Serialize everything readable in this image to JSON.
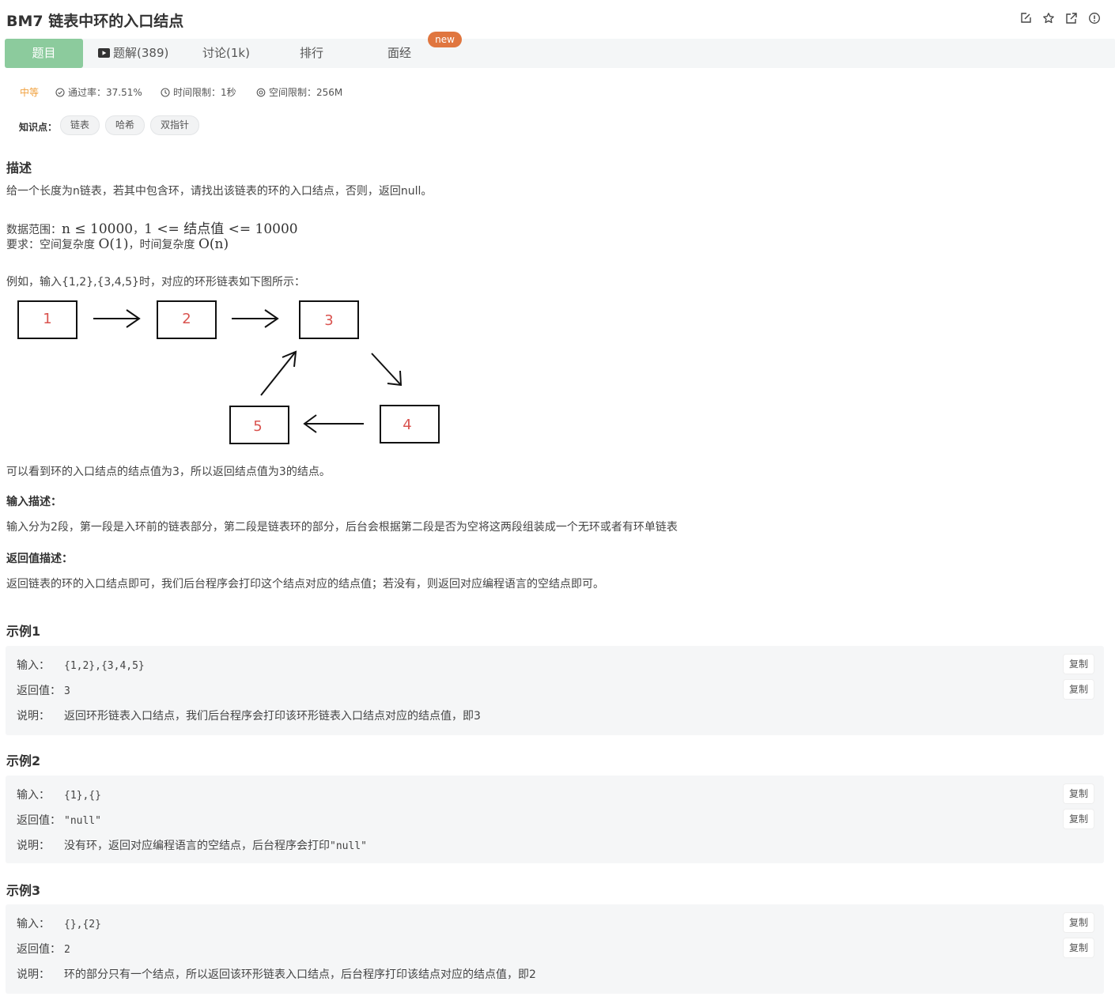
{
  "header": {
    "title": "BM7  链表中环的入口结点",
    "icons": [
      "edit-icon",
      "star-icon",
      "share-icon",
      "report-icon"
    ]
  },
  "tabs": [
    {
      "label": "题目",
      "active": true
    },
    {
      "label": "题解(389)",
      "icon": "video-icon"
    },
    {
      "label": "讨论(1k)"
    },
    {
      "label": "排行"
    },
    {
      "label": "面经"
    }
  ],
  "new_badge": "new",
  "meta": {
    "difficulty": "中等",
    "pass_rate": "通过率：37.51%",
    "time_limit": "时间限制：1秒",
    "space_limit": "空间限制：256M"
  },
  "knowledge": {
    "label": "知识点：",
    "tags": [
      "链表",
      "哈希",
      "双指针"
    ]
  },
  "description": {
    "heading": "描述",
    "p1": "给一个长度为n链表，若其中包含环，请找出该链表的环的入口结点，否则，返回null。",
    "range_prefix": "数据范围：",
    "range_math1": "n ≤ 10000",
    "range_sep": "，",
    "range_math2": "1 <= 结点值 <= 10000",
    "req_prefix": "要求：空间复杂度 ",
    "req_math1": "O(1)",
    "req_mid": "，时间复杂度 ",
    "req_math2": "O(n)",
    "example_intro": "例如，输入{1,2},{3,4,5}时，对应的环形链表如下图所示：",
    "diagram_nodes": [
      "1",
      "2",
      "3",
      "4",
      "5"
    ],
    "after_diagram": "可以看到环的入口结点的结点值为3，所以返回结点值为3的结点。"
  },
  "input_desc": {
    "heading": "输入描述：",
    "text": "输入分为2段，第一段是入环前的链表部分，第二段是链表环的部分，后台会根据第二段是否为空将这两段组装成一个无环或者有环单链表"
  },
  "return_desc": {
    "heading": "返回值描述：",
    "text": "返回链表的环的入口结点即可，我们后台程序会打印这个结点对应的结点值；若没有，则返回对应编程语言的空结点即可。"
  },
  "labels": {
    "input": "输入：",
    "output": "返回值：",
    "explain": "说明：",
    "copy": "复制"
  },
  "examples": [
    {
      "heading": "示例1",
      "input": "{1,2},{3,4,5}",
      "output": "3",
      "explain": "返回环形链表入口结点，我们后台程序会打印该环形链表入口结点对应的结点值，即3"
    },
    {
      "heading": "示例2",
      "input": "{1},{}",
      "output": "\"null\"",
      "explain_prefix": "没有环，返回对应编程语言的空结点，后台程序会打印",
      "explain_code": "\"null\""
    },
    {
      "heading": "示例3",
      "input": "{},{2}",
      "output": "2",
      "explain": "环的部分只有一个结点，所以返回该环形链表入口结点，后台程序打印该结点对应的结点值，即2"
    }
  ],
  "colors": {
    "accent_green": "#8ccb9d",
    "badge_orange": "#e0763f",
    "difficulty_orange": "#f0a03c",
    "node_red": "#d9534f"
  }
}
